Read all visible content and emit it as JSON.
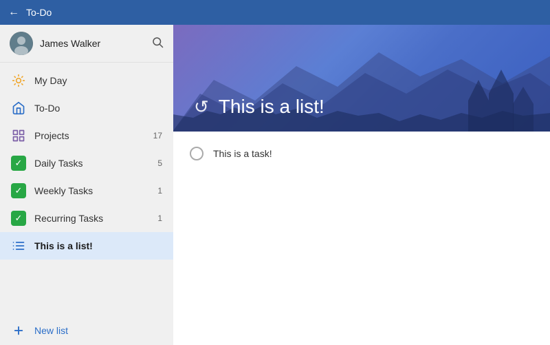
{
  "titleBar": {
    "title": "To-Do",
    "backLabel": "←"
  },
  "sidebar": {
    "user": {
      "name": "James Walker"
    },
    "navItems": [
      {
        "id": "my-day",
        "label": "My Day",
        "icon": "sun",
        "count": null
      },
      {
        "id": "to-do",
        "label": "To-Do",
        "icon": "home",
        "count": null
      },
      {
        "id": "projects",
        "label": "Projects",
        "icon": "grid",
        "count": "17"
      },
      {
        "id": "daily-tasks",
        "label": "Daily Tasks",
        "icon": "check",
        "count": "5"
      },
      {
        "id": "weekly-tasks",
        "label": "Weekly Tasks",
        "icon": "check",
        "count": "1"
      },
      {
        "id": "recurring-tasks",
        "label": "Recurring Tasks",
        "icon": "check",
        "count": "1"
      },
      {
        "id": "this-is-a-list",
        "label": "This is a list!",
        "icon": "list",
        "count": null,
        "active": true
      }
    ],
    "newList": {
      "label": "New list"
    }
  },
  "content": {
    "header": {
      "icon": "↺",
      "title": "This is a list!"
    },
    "tasks": [
      {
        "id": "task-1",
        "text": "This is a task!",
        "completed": false
      }
    ]
  }
}
